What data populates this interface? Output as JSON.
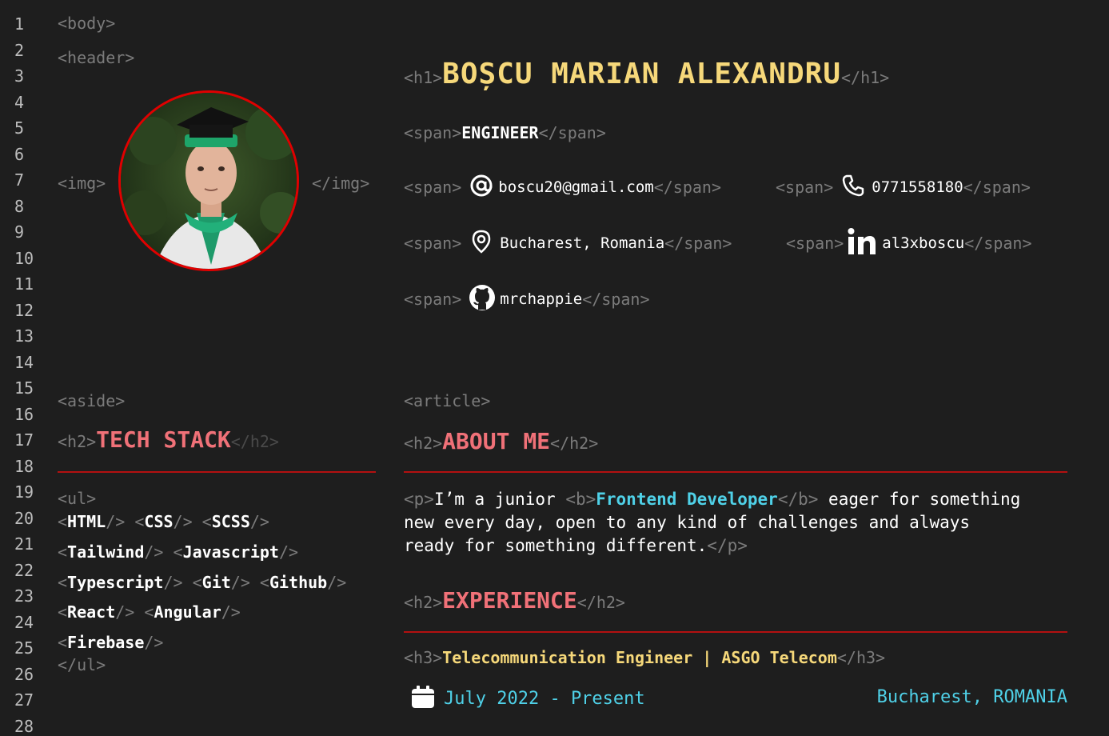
{
  "line_numbers": [
    "1",
    "2",
    "3",
    "4",
    "5",
    "6",
    "7",
    "8",
    "9",
    "10",
    "11",
    "12",
    "13",
    "14",
    "15",
    "16",
    "17",
    "18",
    "19",
    "20",
    "21",
    "22",
    "23",
    "24",
    "25",
    "26",
    "27",
    "28"
  ],
  "tags": {
    "body_open": "<body>",
    "header_open": "<header>",
    "img_open": "<img>",
    "img_close": "</img>",
    "h1_open": "<h1>",
    "h1_close": "</h1>",
    "span_open": "<span>",
    "span_close": "</span>",
    "aside_open": "<aside>",
    "article_open": "<article>",
    "h2_open": "<h2>",
    "h2_close": "</h2>",
    "ul_open": "<ul>",
    "ul_close": "</ul>",
    "p_open": "<p>",
    "p_close": "</p>",
    "b_open": "<b>",
    "b_close": "</b>",
    "h3_open": "<h3>",
    "h3_close": "</h3>",
    "lt": "<",
    "self_close": "/>"
  },
  "header": {
    "name": "BOȘCU MARIAN ALEXANDRU",
    "title": "ENGINEER",
    "email": "boscu20@gmail.com",
    "phone": "0771558180",
    "location": "Bucharest, Romania",
    "linkedin": "al3xboscu",
    "github": "mrchappie"
  },
  "aside": {
    "heading": "TECH STACK",
    "stack": [
      "HTML",
      "CSS",
      "SCSS",
      "Tailwind",
      "Javascript",
      "Typescript",
      "Git",
      "Github",
      "React",
      "Angular",
      "Firebase"
    ]
  },
  "article": {
    "about_heading": "ABOUT ME",
    "about_line1_prefix": "I’m a junior ",
    "about_highlight": "Frontend Developer",
    "about_line1_suffix": " eager for something",
    "about_line2": "new every day, open to any kind of challenges and always",
    "about_line3": "ready for something different.",
    "experience_heading": "EXPERIENCE",
    "job_title": "Telecommunication Engineer | ASGO Telecom",
    "job_dates": "July 2022 - Present",
    "job_location": "Bucharest, ROMANIA"
  },
  "colors": {
    "background": "#1e1e1e",
    "tag": "#7b7b7b",
    "name": "#f6d87a",
    "heading": "#f07178",
    "accent": "#4fd1e8",
    "rule": "#b31010"
  },
  "icons": [
    "at-icon",
    "phone-icon",
    "location-pin-icon",
    "linkedin-icon",
    "github-icon",
    "calendar-icon"
  ]
}
